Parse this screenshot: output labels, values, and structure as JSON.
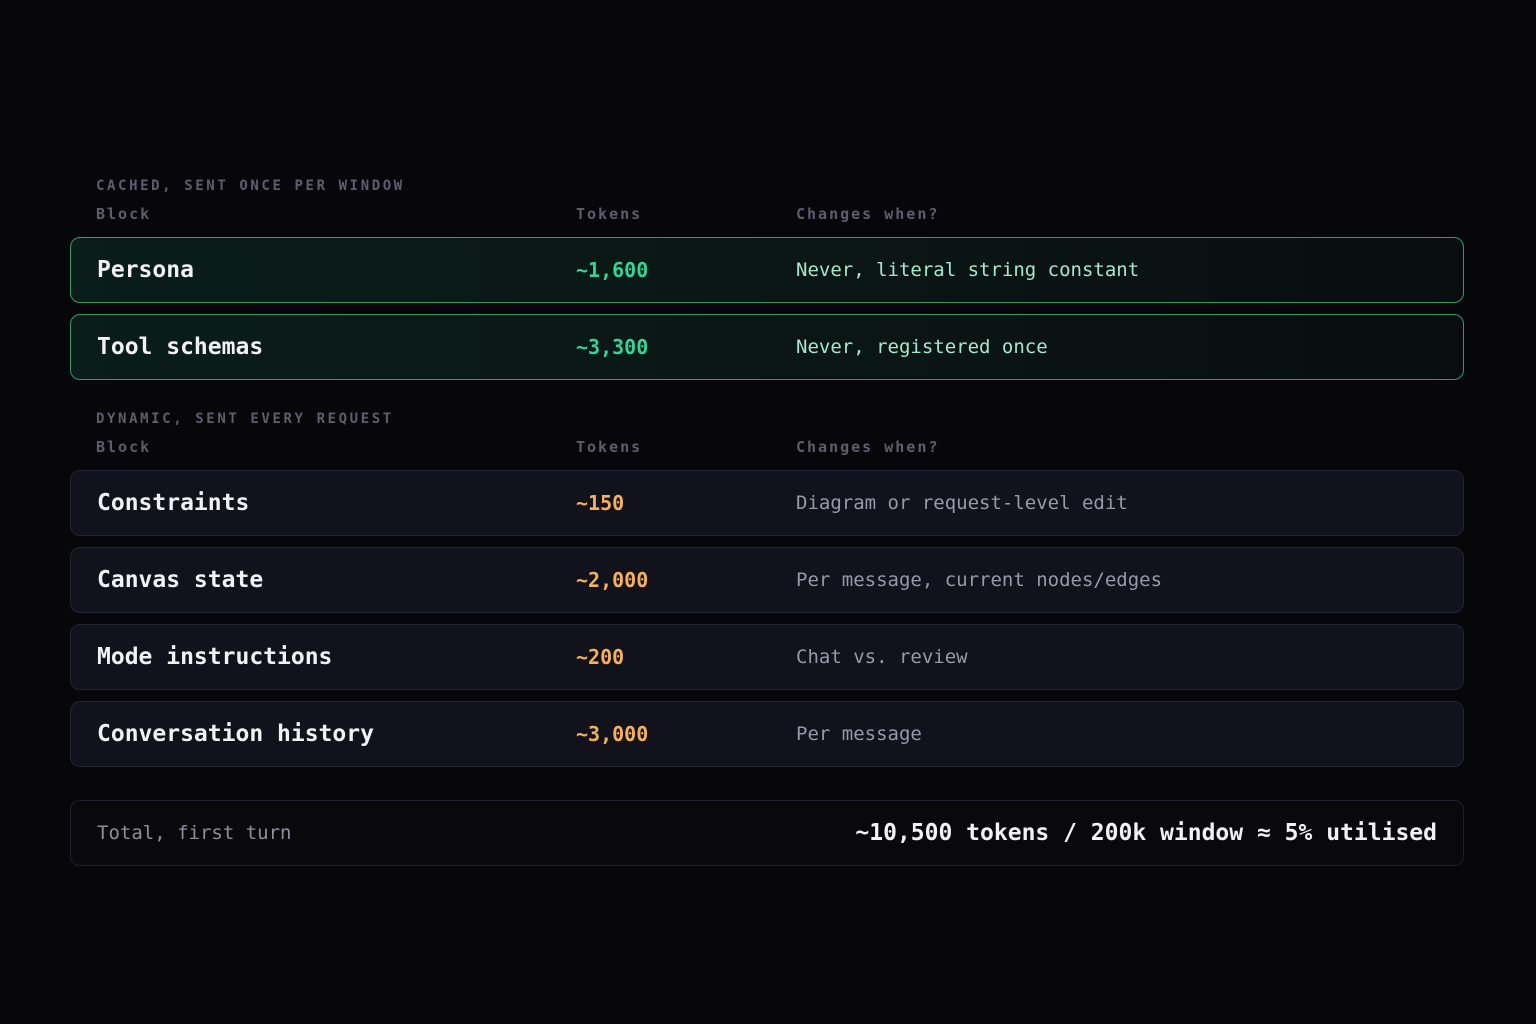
{
  "cached": {
    "label": "CACHED, SENT ONCE PER WINDOW",
    "headers": {
      "block": "Block",
      "tokens": "Tokens",
      "when": "Changes when?"
    },
    "rows": [
      {
        "name": "Persona",
        "tokens": "~1,600",
        "when": "Never, literal string constant"
      },
      {
        "name": "Tool schemas",
        "tokens": "~3,300",
        "when": "Never, registered once"
      }
    ]
  },
  "dynamic": {
    "label": "DYNAMIC, SENT EVERY REQUEST",
    "headers": {
      "block": "Block",
      "tokens": "Tokens",
      "when": "Changes when?"
    },
    "rows": [
      {
        "name": "Constraints",
        "tokens": "~150",
        "when": "Diagram or request-level edit"
      },
      {
        "name": "Canvas state",
        "tokens": "~2,000",
        "when": "Per message, current nodes/edges"
      },
      {
        "name": "Mode instructions",
        "tokens": "~200",
        "when": "Chat vs. review"
      },
      {
        "name": "Conversation history",
        "tokens": "~3,000",
        "when": "Per message"
      }
    ]
  },
  "total": {
    "label": "Total, first turn",
    "value": "~10,500 tokens / 200k window ≈ 5% utilised"
  },
  "colors": {
    "background": "#07070b",
    "cached_accent": "#34d399",
    "cached_border": "#2f9c68",
    "dynamic_accent": "#f5b05c",
    "muted_label": "#5e5d6e"
  }
}
